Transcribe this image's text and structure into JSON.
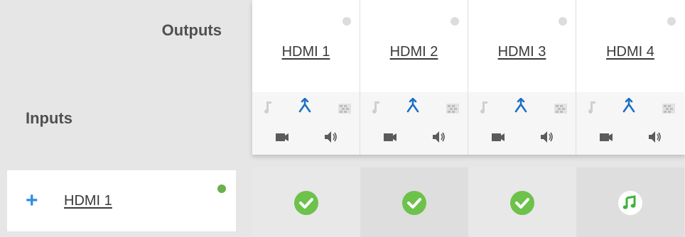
{
  "header": {
    "outputs_label": "Outputs",
    "inputs_label": "Inputs"
  },
  "outputs": [
    {
      "label": "HDMI 1",
      "status": "inactive"
    },
    {
      "label": "HDMI 2",
      "status": "inactive"
    },
    {
      "label": "HDMI 3",
      "status": "inactive"
    },
    {
      "label": "HDMI 4",
      "status": "inactive"
    }
  ],
  "output_icons": [
    "audio-note-icon",
    "merge-routing-icon",
    "grid-pattern-icon",
    "video-camera-icon",
    "speaker-icon"
  ],
  "inputs": [
    {
      "label": "HDMI 1",
      "status": "active",
      "expand_icon": "plus-icon"
    }
  ],
  "routing_matrix": [
    [
      "check-icon",
      "check-icon",
      "check-icon",
      "music-note-icon"
    ]
  ],
  "colors": {
    "accent_blue": "#1c6fc4",
    "check_green": "#6cc24a",
    "music_green": "#3db33d",
    "status_active": "#6ab04c",
    "status_inactive": "#dcdcdc"
  }
}
